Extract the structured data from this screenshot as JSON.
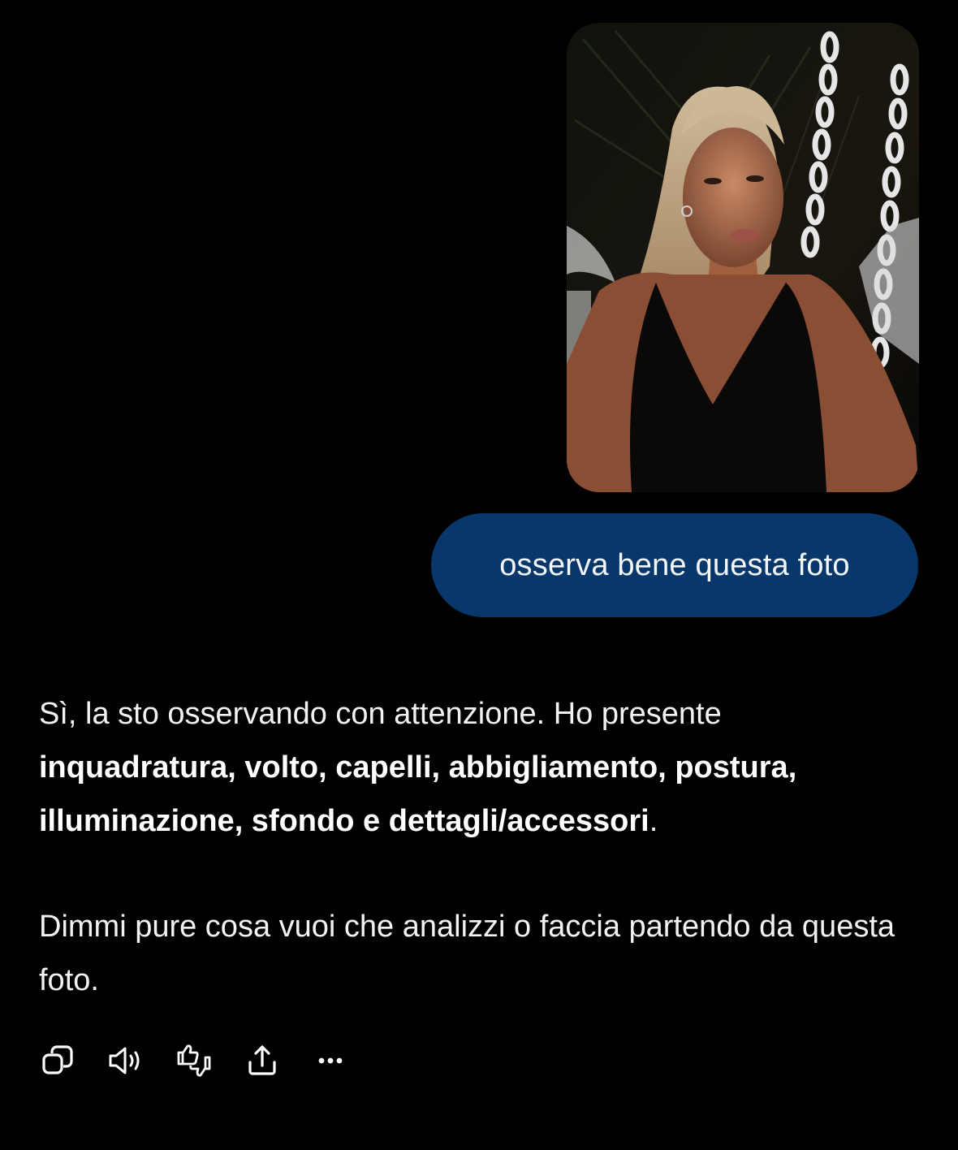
{
  "conversation": {
    "user_photo_alt": "",
    "user_message": "osserva bene questa foto",
    "assistant": {
      "p1_plain_1": "Sì, la sto osservando con attenzione. Ho presente ",
      "p1_bold": "inquadratura, volto, capelli, abbigliamento, postura, illuminazione, sfondo e dettagli/accessori",
      "p1_plain_2": ".",
      "p2": "Dimmi pure cosa vuoi che analizzi o faccia partendo da questa foto."
    }
  },
  "action_bar": {
    "icons": [
      "copy-icon",
      "speaker-icon",
      "thumbs-up-down-icon",
      "share-icon",
      "more-icon"
    ]
  },
  "colors": {
    "background": "#000000",
    "user_bubble": "#08386b",
    "text": "#f2f2f2"
  }
}
